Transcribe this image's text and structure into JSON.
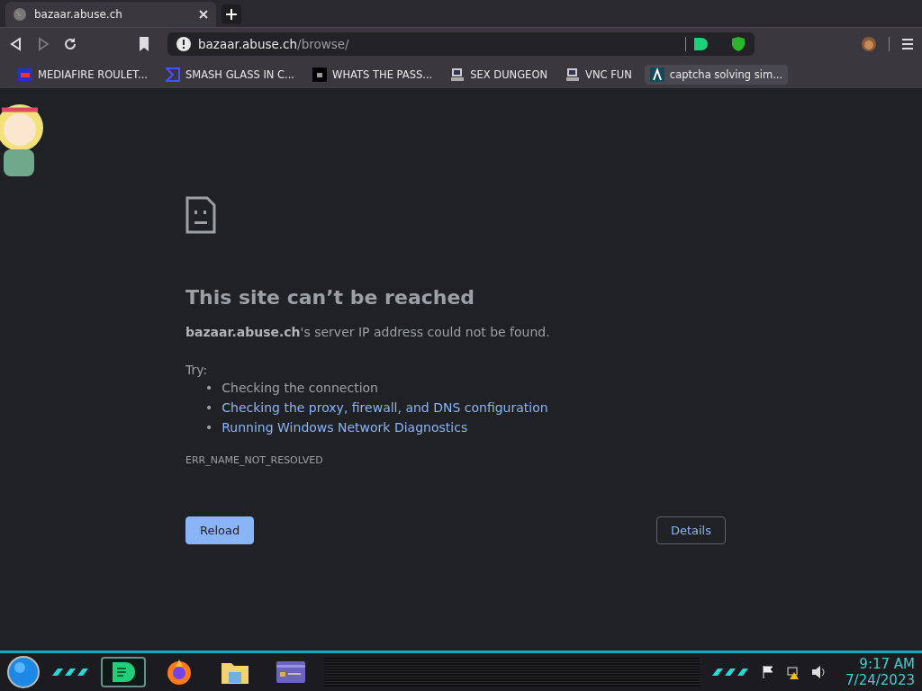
{
  "tab": {
    "title": "bazaar.abuse.ch",
    "selected": true
  },
  "address": {
    "host": "bazaar.abuse.ch",
    "path": "/browse/"
  },
  "bookmarks": [
    {
      "label": "MEDIAFIRE ROULET...",
      "hovered": false
    },
    {
      "label": "SMASH GLASS IN C...",
      "hovered": false
    },
    {
      "label": "WHATS THE PASS...",
      "hovered": false
    },
    {
      "label": "SEX DUNGEON",
      "hovered": false
    },
    {
      "label": "VNC FUN",
      "hovered": false
    },
    {
      "label": "captcha solving sim...",
      "hovered": true
    }
  ],
  "error": {
    "title": "This site can’t be reached",
    "message": "**bazaar.abuse.ch**'s server IP address could not be found.",
    "try_label": "Try:",
    "suggestions": [
      {
        "bullet": "•",
        "text": "Checking the connection",
        "kind": "text"
      },
      {
        "bullet": "•",
        "text": "Checking the proxy, firewall, and DNS configuration",
        "kind": "link"
      },
      {
        "bullet": "•",
        "text": "Running Windows Network Diagnostics",
        "kind": "link"
      }
    ],
    "code": "ERR_NAME_NOT_RESOLVED",
    "buttons": [
      {
        "label": "Reload",
        "kind": "primary"
      },
      {
        "label": "Details",
        "kind": "secondary"
      }
    ]
  },
  "taskbar": {
    "apps": [
      {
        "active": true
      },
      {
        "active": false
      },
      {
        "active": false
      },
      {
        "active": false
      }
    ],
    "time": "9:17 AM",
    "date": "7/24/2023"
  }
}
